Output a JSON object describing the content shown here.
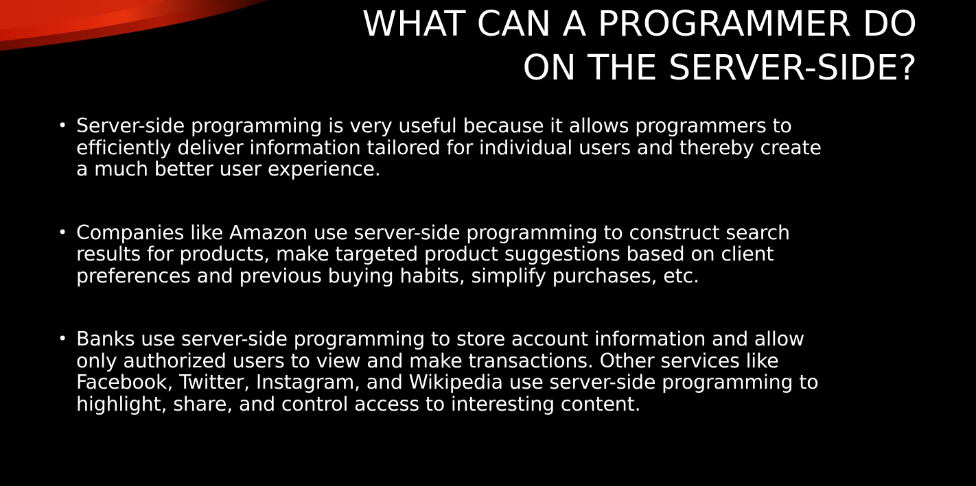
{
  "slide": {
    "title_lines": [
      "WHAT CAN A PROGRAMMER DO",
      "ON THE SERVER-SIDE?"
    ],
    "bullets": [
      {
        "lines": [
          "Server-side programming is very useful because it allows programmers to",
          "efficiently deliver information tailored for individual users and thereby create",
          "a much better user experience."
        ]
      },
      {
        "lines": [
          "Companies like Amazon use server-side programming to construct search",
          "results for products, make targeted product suggestions based on client",
          "preferences and previous buying habits, simplify purchases, etc."
        ]
      },
      {
        "lines": [
          "Banks use server-side programming to store account information and allow",
          "only authorized users to view and make transactions. Other services like",
          "Facebook, Twitter, Instagram, and Wikipedia use server-side programming to",
          "highlight, share, and control access to interesting content."
        ]
      }
    ],
    "bullet_glyph": "•",
    "colors": {
      "background": "#000000",
      "text": "#ffffff",
      "accent_red": "#d81e05",
      "accent_dark_red": "#7a0c02"
    }
  }
}
